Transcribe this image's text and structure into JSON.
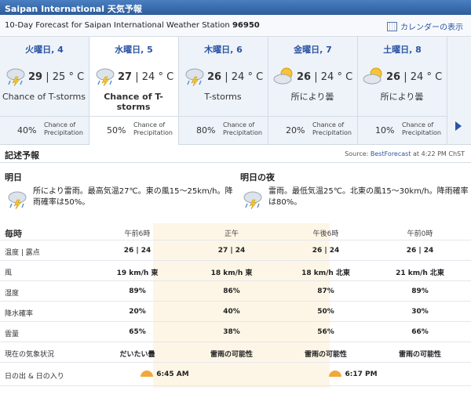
{
  "header": {
    "title": "Saipan International 天気予報",
    "subtitle": "10-Day Forecast for Saipan International Weather Station",
    "station_id": "96950",
    "calendar_label": "カレンダーの表示"
  },
  "days": [
    {
      "name": "火曜日, 4",
      "high": "29",
      "low": "25",
      "unit": "° C",
      "cond": "Chance of T-storms",
      "pop": "40%",
      "icon": "thunderstorm-icon"
    },
    {
      "name": "水曜日, 5",
      "high": "27",
      "low": "24",
      "unit": "° C",
      "cond": "Chance of T-storms",
      "pop": "50%",
      "icon": "thunderstorm-icon"
    },
    {
      "name": "木曜日, 6",
      "high": "26",
      "low": "24",
      "unit": "° C",
      "cond": "T-storms",
      "pop": "80%",
      "icon": "thunderstorm-icon"
    },
    {
      "name": "金曜日, 7",
      "high": "26",
      "low": "24",
      "unit": "° C",
      "cond": "所により曇",
      "pop": "20%",
      "icon": "partly-cloudy-icon"
    },
    {
      "name": "土曜日, 8",
      "high": "26",
      "low": "24",
      "unit": "° C",
      "cond": "所により曇",
      "pop": "10%",
      "icon": "partly-cloudy-icon"
    }
  ],
  "chance_label_1": "Chance of",
  "chance_label_2": "Precipitation",
  "narrative": {
    "heading": "記述予報",
    "source_prefix": "Source:",
    "source_link": "BestForecast",
    "source_time": "at 4:22 PM ChST",
    "today_title": "明日",
    "today_text": "所により雷雨。最高気温27℃。東の風15〜25km/h。降雨確率は50%。",
    "tonight_title": "明日の夜",
    "tonight_text": "雷雨。最低気温25℃。北東の風15〜30km/h。降雨確率は80%。"
  },
  "hourly": {
    "heading": "毎時",
    "times": [
      "午前6時",
      "正午",
      "午後6時",
      "午前0時"
    ],
    "rows": [
      {
        "label": "温度 | 露点",
        "cells": [
          "26 | 24",
          "27 | 24",
          "26 | 24",
          "26 | 24"
        ]
      },
      {
        "label": "風",
        "cells": [
          "19 km/h 東",
          "18 km/h 東",
          "18 km/h 北東",
          "21 km/h 北東"
        ]
      },
      {
        "label": "湿度",
        "cells": [
          "89%",
          "86%",
          "87%",
          "89%"
        ]
      },
      {
        "label": "降水確率",
        "cells": [
          "20%",
          "40%",
          "50%",
          "30%"
        ]
      },
      {
        "label": "雲量",
        "cells": [
          "65%",
          "38%",
          "56%",
          "66%"
        ]
      },
      {
        "label": "現在の気象状況",
        "cells": [
          "だいたい曇",
          "雷雨の可能性",
          "雷雨の可能性",
          "雷雨の可能性"
        ]
      }
    ],
    "sun_label": "日の出 & 日の入り",
    "sunrise": "6:45 AM",
    "sunset": "6:17 PM"
  },
  "colors": {
    "accent": "#2b55a3",
    "title_bar": "#3a6cb0",
    "day_shade": "#fdf6e6",
    "sun": "#f3a73a"
  }
}
